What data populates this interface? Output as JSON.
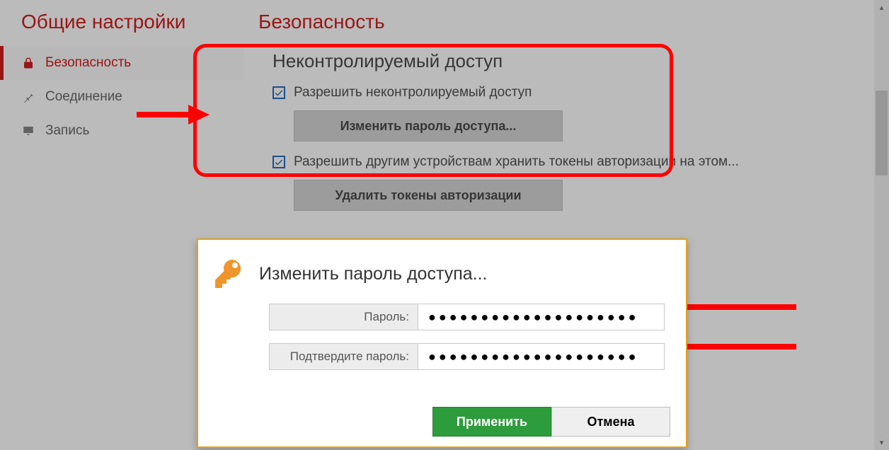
{
  "sidebar": {
    "title": "Общие настройки",
    "items": [
      {
        "label": "Безопасность",
        "icon": "lock"
      },
      {
        "label": "Соединение",
        "icon": "pin"
      },
      {
        "label": "Запись",
        "icon": "display"
      }
    ]
  },
  "main": {
    "title": "Безопасность",
    "section1": {
      "heading": "Неконтролируемый доступ",
      "checkbox_label": "Разрешить неконтролируемый доступ",
      "button_label": "Изменить пароль доступа..."
    },
    "section2": {
      "checkbox_label": "Разрешить другим устройствам хранить токены авторизации на этом...",
      "button_label": "Удалить токены авторизации"
    }
  },
  "modal": {
    "title": "Изменить пароль доступа...",
    "password_label": "Пароль:",
    "confirm_label": "Подтвердите пароль:",
    "password_value": "●●●●●●●●●●●●●●●●●●●●",
    "confirm_value": "●●●●●●●●●●●●●●●●●●●●",
    "apply_label": "Применить",
    "cancel_label": "Отмена"
  }
}
